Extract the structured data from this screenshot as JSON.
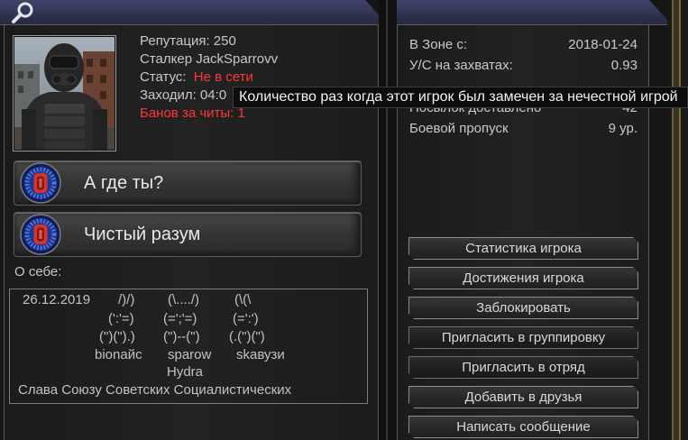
{
  "header": {
    "search_icon": "search-icon"
  },
  "profile": {
    "reputation": "Репутация: 250",
    "stalker_name": "Сталкер JackSparrovv",
    "status_label": "Статус:",
    "status_value": "Не в сети",
    "last_seen": "Заходил: 04:0",
    "cheat_bans": "Банов за читы: 1"
  },
  "tooltip": {
    "text": "Количество раз когда этот игрок был замечен за нечестной игрой"
  },
  "achievements": [
    {
      "label": "А где ты?",
      "icon": "achievement-badge-icon"
    },
    {
      "label": "Чистый разум",
      "icon": "achievement-badge-icon"
    }
  ],
  "about": {
    "heading": "О себе:",
    "date": "26.12.2019",
    "art": [
      [
        "/)/)",
        "(\\..../)",
        "(\\(\\"
      ],
      [
        "(':'=)",
        "(=';'=)",
        "(=':')"
      ],
      [
        "(\")(\").)",
        "(\")--(\")",
        "(.(\")(\")"
      ],
      [
        "bionaйс",
        "sparow",
        "skaвузи"
      ]
    ],
    "highlight": "Hydra",
    "footer": "Слава Союзу Советских Социалистических"
  },
  "stats": [
    {
      "label": "В Зоне с:",
      "value": "2018-01-24"
    },
    {
      "label": "У/С на захватах:",
      "value": "0.93"
    },
    {
      "label": "Посылок доставлено",
      "value": "42"
    },
    {
      "label": "Боевой пропуск",
      "value": "9 ур."
    }
  ],
  "actions": [
    "Статистика игрока",
    "Достижения игрока",
    "Заблокировать",
    "Пригласить в группировку",
    "Пригласить в отряд",
    "Добавить в друзья",
    "Написать сообщение"
  ],
  "colors": {
    "text": "#c8c8c8",
    "alert": "#ff3636",
    "header": "#2c2f4a",
    "panel": "#1e1e1e",
    "button_border": "#8c8c8c"
  }
}
